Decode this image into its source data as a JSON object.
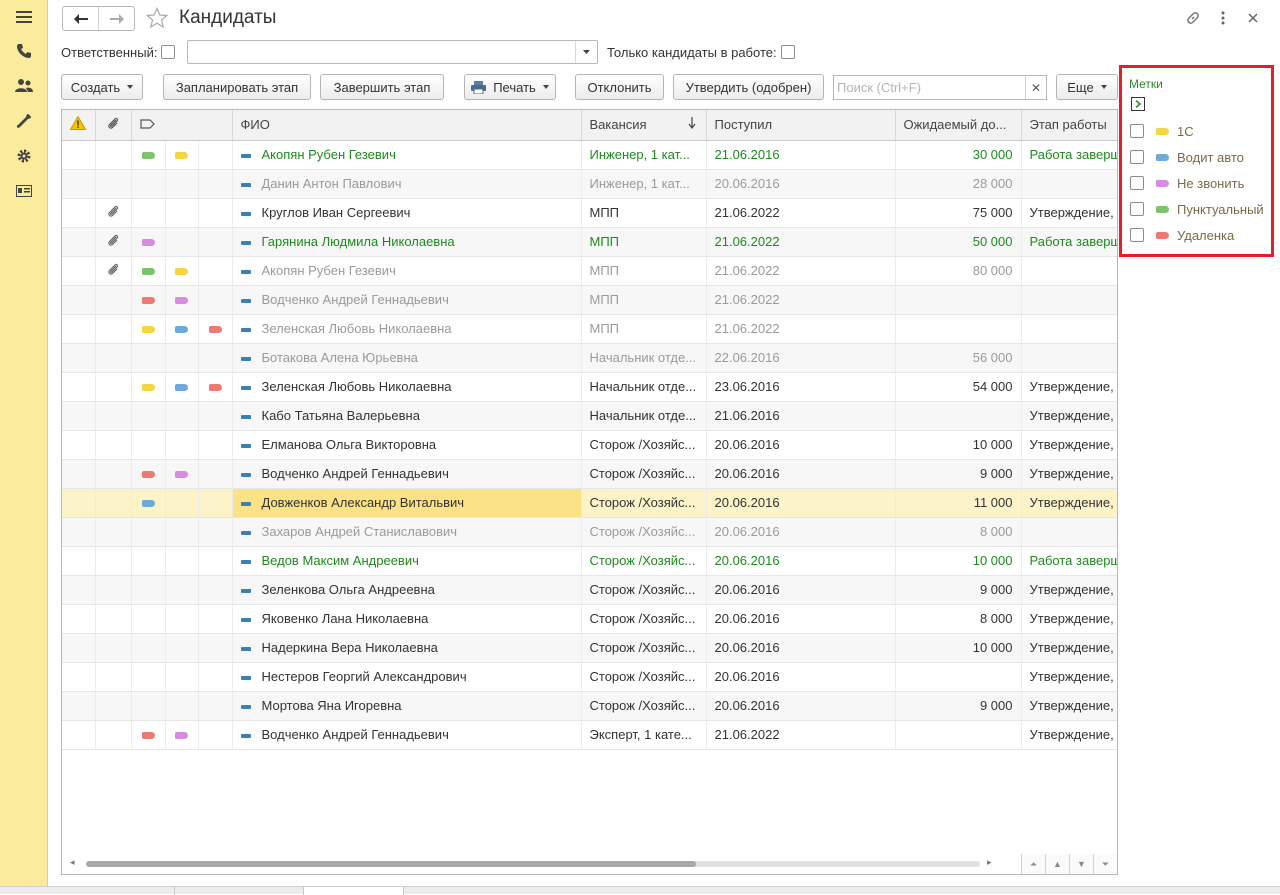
{
  "title": "Кандидаты",
  "filters": {
    "responsible_label": "Ответственный:",
    "responsible_value": "",
    "only_active_label": "Только кандидаты в работе:"
  },
  "toolbar": {
    "create": "Создать",
    "plan_stage": "Запланировать этап",
    "finish_stage": "Завершить этап",
    "print": "Печать",
    "reject": "Отклонить",
    "approve": "Утвердить (одобрен)",
    "search_placeholder": "Поиск (Ctrl+F)",
    "more": "Еще"
  },
  "table": {
    "columns": [
      "ФИО",
      "Вакансия",
      "Поступил",
      "Ожидаемый до...",
      "Этап работы"
    ],
    "rows": [
      {
        "tags": [
          "green",
          "yellow"
        ],
        "attach": false,
        "fio": "Акопян Рубен Гезевич",
        "vac": "Инженер, 1 кат...",
        "date": "21.06.2016",
        "exp": "30 000",
        "stage": "Работа заверш...",
        "state": "green"
      },
      {
        "tags": [],
        "attach": false,
        "fio": "Данин Антон Павлович",
        "vac": "Инженер, 1 кат...",
        "date": "20.06.2016",
        "exp": "28 000",
        "stage": "",
        "state": "gray"
      },
      {
        "tags": [],
        "attach": true,
        "fio": "Круглов Иван Сергеевич",
        "vac": "МПП",
        "date": "21.06.2022",
        "exp": "75 000",
        "stage": "Утверждение, ...",
        "state": "normal"
      },
      {
        "tags": [
          "violet"
        ],
        "attach": true,
        "fio": "Гарянина Людмила Николаевна",
        "vac": "МПП",
        "date": "21.06.2022",
        "exp": "50 000",
        "stage": "Работа заверш...",
        "state": "green"
      },
      {
        "tags": [
          "green",
          "yellow"
        ],
        "attach": true,
        "fio": "Акопян Рубен Гезевич",
        "vac": "МПП",
        "date": "21.06.2022",
        "exp": "80 000",
        "stage": "",
        "state": "gray"
      },
      {
        "tags": [
          "red",
          "violet"
        ],
        "attach": false,
        "fio": "Водченко Андрей Геннадьевич",
        "vac": "МПП",
        "date": "21.06.2022",
        "exp": "",
        "stage": "",
        "state": "gray"
      },
      {
        "tags": [
          "yellow",
          "blue",
          "red"
        ],
        "attach": false,
        "fio": "Зеленская Любовь Николаевна",
        "vac": "МПП",
        "date": "21.06.2022",
        "exp": "",
        "stage": "",
        "state": "gray"
      },
      {
        "tags": [],
        "attach": false,
        "fio": "Ботакова Алена Юрьевна",
        "vac": "Начальник отде...",
        "date": "22.06.2016",
        "exp": "56 000",
        "stage": "",
        "state": "gray"
      },
      {
        "tags": [
          "yellow",
          "blue",
          "red"
        ],
        "attach": false,
        "fio": "Зеленская Любовь Николаевна",
        "vac": "Начальник отде...",
        "date": "23.06.2016",
        "exp": "54 000",
        "stage": "Утверждение, ...",
        "state": "normal"
      },
      {
        "tags": [],
        "attach": false,
        "fio": "Кабо Татьяна Валерьевна",
        "vac": "Начальник отде...",
        "date": "21.06.2016",
        "exp": "",
        "stage": "Утверждение, ...",
        "state": "normal"
      },
      {
        "tags": [],
        "attach": false,
        "fio": "Елманова Ольга Викторовна",
        "vac": "Сторож /Хозяйс...",
        "date": "20.06.2016",
        "exp": "10 000",
        "stage": "Утверждение, ...",
        "state": "normal"
      },
      {
        "tags": [
          "red",
          "violet"
        ],
        "attach": false,
        "fio": "Водченко Андрей Геннадьевич",
        "vac": "Сторож /Хозяйс...",
        "date": "20.06.2016",
        "exp": "9 000",
        "stage": "Утверждение, ...",
        "state": "normal"
      },
      {
        "tags": [
          "blue"
        ],
        "attach": false,
        "fio": "Довженков Александр Витальвич",
        "vac": "Сторож /Хозяйс...",
        "date": "20.06.2016",
        "exp": "11 000",
        "stage": "Утверждение, ...",
        "state": "normal",
        "selected": true
      },
      {
        "tags": [],
        "attach": false,
        "fio": "Захаров Андрей Станиславович",
        "vac": "Сторож /Хозяйс...",
        "date": "20.06.2016",
        "exp": "8 000",
        "stage": "",
        "state": "gray"
      },
      {
        "tags": [],
        "attach": false,
        "fio": "Ведов Максим Андреевич",
        "vac": "Сторож /Хозяйс...",
        "date": "20.06.2016",
        "exp": "10 000",
        "stage": "Работа заверш...",
        "state": "green"
      },
      {
        "tags": [],
        "attach": false,
        "fio": "Зеленкова Ольга Андреевна",
        "vac": "Сторож /Хозяйс...",
        "date": "20.06.2016",
        "exp": "9 000",
        "stage": "Утверждение, ...",
        "state": "normal"
      },
      {
        "tags": [],
        "attach": false,
        "fio": "Яковенко Лана Николаевна",
        "vac": "Сторож /Хозяйс...",
        "date": "20.06.2016",
        "exp": "8 000",
        "stage": "Утверждение, ...",
        "state": "normal"
      },
      {
        "tags": [],
        "attach": false,
        "fio": "Надеркина Вера Николаевна",
        "vac": "Сторож /Хозяйс...",
        "date": "20.06.2016",
        "exp": "10 000",
        "stage": "Утверждение, ...",
        "state": "normal"
      },
      {
        "tags": [],
        "attach": false,
        "fio": "Нестеров Георгий Александрович",
        "vac": "Сторож /Хозяйс...",
        "date": "20.06.2016",
        "exp": "",
        "stage": "Утверждение, ...",
        "state": "normal"
      },
      {
        "tags": [],
        "attach": false,
        "fio": "Мортова Яна Игоревна",
        "vac": "Сторож /Хозяйс...",
        "date": "20.06.2016",
        "exp": "9 000",
        "stage": "Утверждение, ...",
        "state": "normal"
      },
      {
        "tags": [
          "red",
          "violet"
        ],
        "attach": false,
        "fio": "Водченко Андрей Геннадьевич",
        "vac": "Эксперт, 1 кате...",
        "date": "21.06.2022",
        "exp": "",
        "stage": "Утверждение, ...",
        "state": "normal"
      }
    ]
  },
  "tags_panel": {
    "title": "Метки",
    "items": [
      {
        "label": "1С",
        "color": "yellow"
      },
      {
        "label": "Водит авто",
        "color": "blue"
      },
      {
        "label": "Не звонить",
        "color": "violet"
      },
      {
        "label": "Пунктуальный",
        "color": "green"
      },
      {
        "label": "Удаленка",
        "color": "red"
      }
    ]
  },
  "tag_colors": {
    "green": "#7cc36a",
    "yellow": "#f2d73f",
    "violet": "#d68de0",
    "red": "#ec7a72",
    "blue": "#6fa9d8"
  },
  "icons": {
    "sidebar": [
      "menu-icon",
      "phone-icon",
      "people-icon",
      "wrench-icon",
      "gear-icon",
      "id-card-icon"
    ],
    "window": [
      "link-icon",
      "more-icon",
      "close-icon"
    ]
  }
}
